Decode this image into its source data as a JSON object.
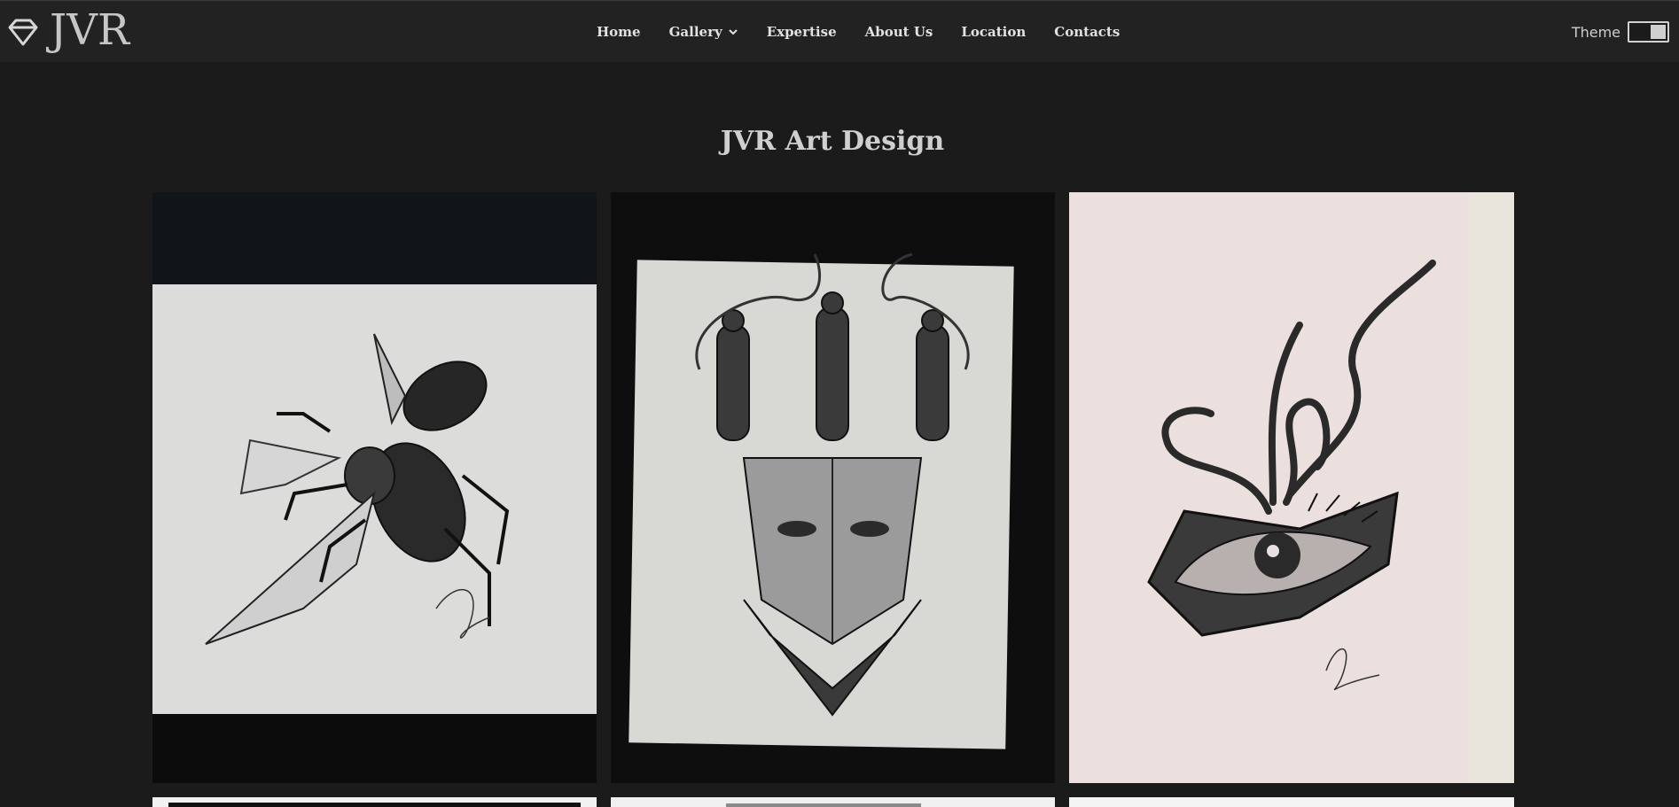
{
  "header": {
    "brand": "JVR",
    "nav": [
      {
        "label": "Home"
      },
      {
        "label": "Gallery",
        "has_dropdown": true
      },
      {
        "label": "Expertise"
      },
      {
        "label": "About Us"
      },
      {
        "label": "Location"
      },
      {
        "label": "Contacts"
      }
    ],
    "theme_label": "Theme",
    "theme_toggle_on": true
  },
  "main": {
    "title": "JVR Art Design",
    "gallery": [
      {
        "icon": "beetle-artwork"
      },
      {
        "icon": "crowned-face-artwork"
      },
      {
        "icon": "eye-flame-artwork"
      },
      {
        "icon": "artwork"
      },
      {
        "icon": "artwork"
      },
      {
        "icon": "artwork"
      }
    ]
  },
  "colors": {
    "background": "#1b1b1b",
    "topbar": "#222222",
    "text": "#e2e2e2",
    "paper_pink": "#ece0de"
  }
}
